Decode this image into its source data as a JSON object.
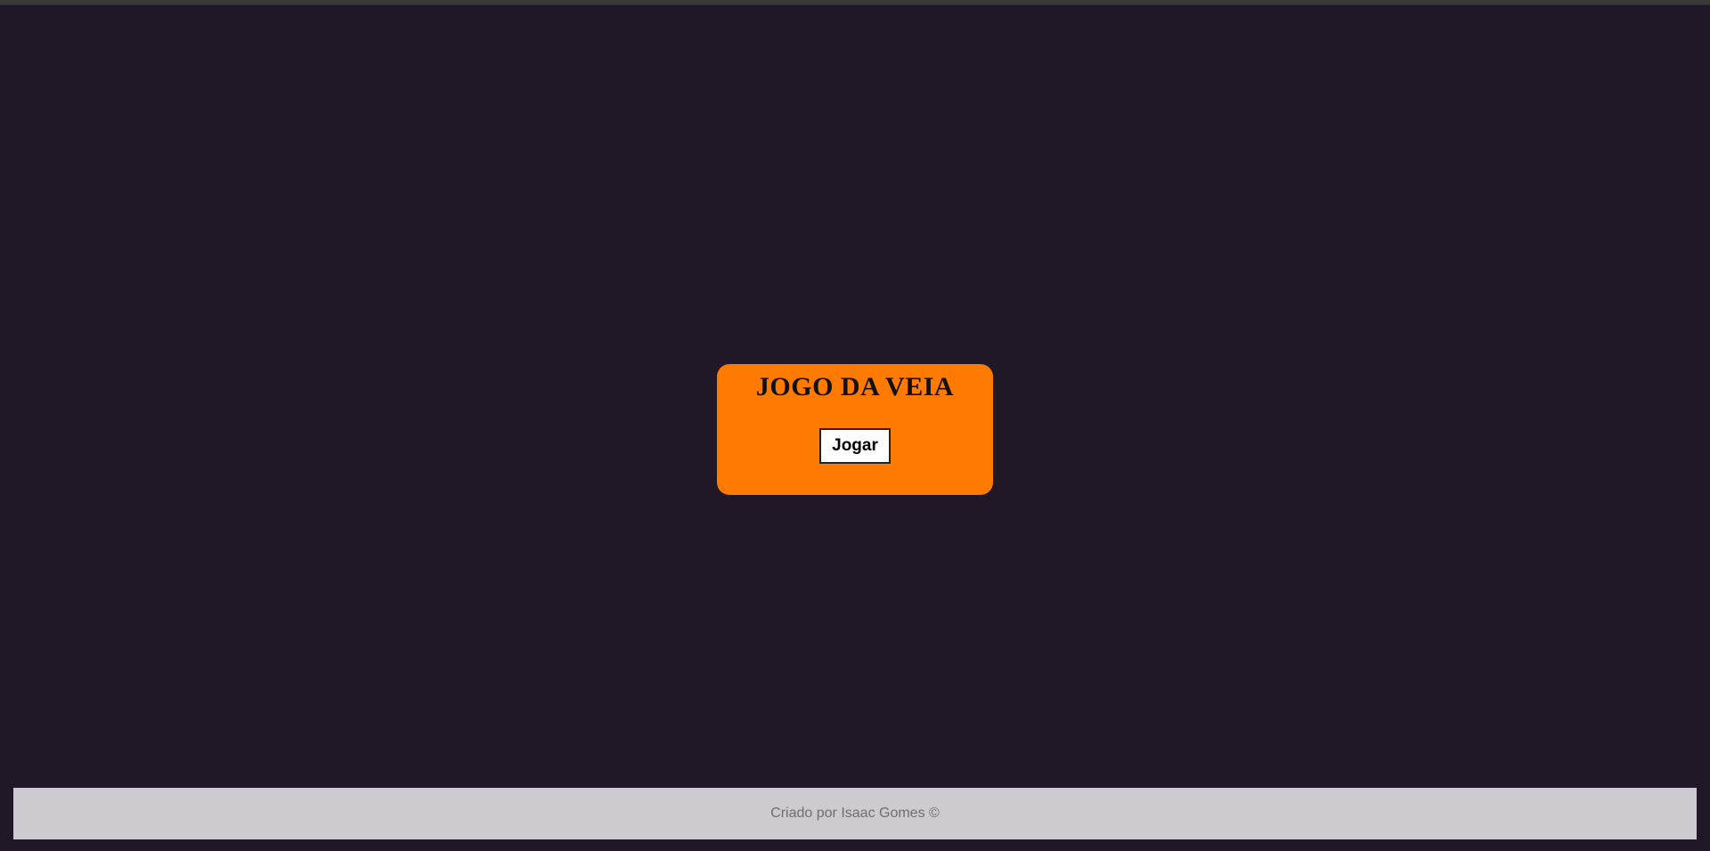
{
  "colors": {
    "background": "#201827",
    "card": "#ff7a00",
    "footer": "#cdcbd0",
    "footer_text": "#6e6e72"
  },
  "menu": {
    "title": "JOGO DA VEIA",
    "play_label": "Jogar"
  },
  "footer": {
    "credit": "Criado por Isaac Gomes ©"
  }
}
